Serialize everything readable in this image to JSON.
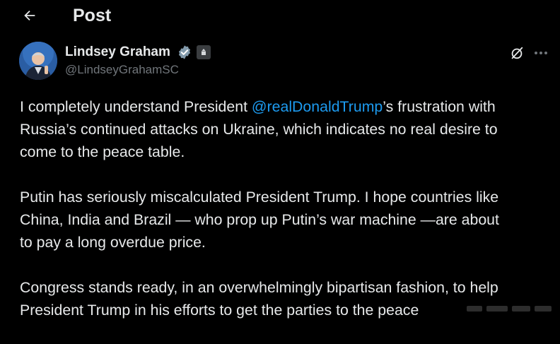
{
  "header": {
    "back_icon": "arrow-left-icon",
    "title": "Post"
  },
  "author": {
    "name": "Lindsey Graham",
    "handle": "@LindseyGrahamSC",
    "verified_icon": "verified-check-icon",
    "badge_icon": "government-badge-icon",
    "verified_color": "#829aab"
  },
  "actions": {
    "grok_icon": "grok-icon",
    "more_icon": "more-dots-icon"
  },
  "post": {
    "p1_l1_pre": "I completely understand President ",
    "p1_l1_mention": "@realDonaldTrump",
    "p1_l1_post": "’s frustration with",
    "p1_l2": "Russia’s continued attacks on Ukraine, which indicates no real desire to",
    "p1_l3": "come to the peace table.",
    "p2_l1": "Putin has seriously miscalculated President Trump. I hope countries like",
    "p2_l2": "China, India and Brazil — who prop up Putin’s war machine —are about",
    "p2_l3": "to pay a long overdue price.",
    "p3_l1": "Congress stands ready, in an overwhelmingly bipartisan fashion, to help",
    "p3_l2": "President Trump in his efforts to get the parties to the peace"
  },
  "colors": {
    "background": "#000000",
    "text": "#e7e9ea",
    "secondary": "#71767b",
    "link": "#1d9bf0"
  }
}
